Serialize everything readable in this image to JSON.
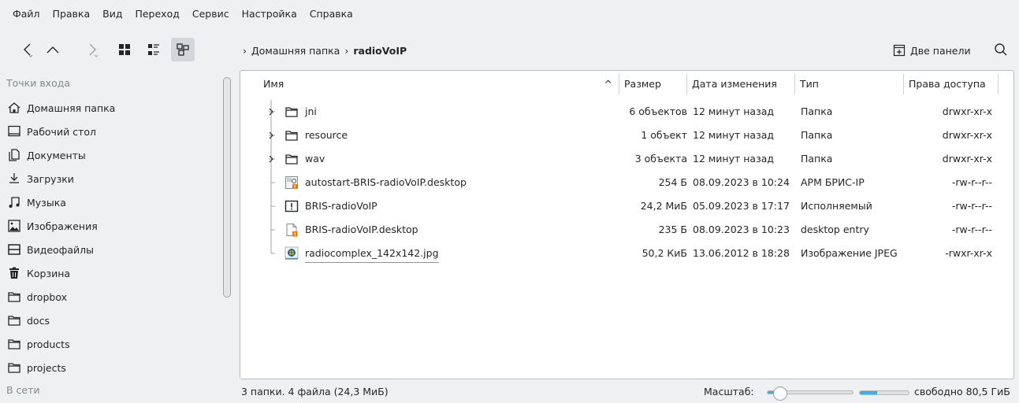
{
  "menu": [
    "Файл",
    "Правка",
    "Вид",
    "Переход",
    "Сервис",
    "Настройка",
    "Справка"
  ],
  "breadcrumb": {
    "home": "Домашняя папка",
    "current": "radioVoIP"
  },
  "toolbar": {
    "two_panels": "Две панели"
  },
  "sidebar": {
    "places_title": "Точки входа",
    "network_title": "В сети",
    "items": [
      {
        "label": "Домашняя папка",
        "icon": "home-icon"
      },
      {
        "label": "Рабочий стол",
        "icon": "desktop-icon"
      },
      {
        "label": "Документы",
        "icon": "documents-icon"
      },
      {
        "label": "Загрузки",
        "icon": "download-icon"
      },
      {
        "label": "Музыка",
        "icon": "music-icon"
      },
      {
        "label": "Изображения",
        "icon": "pictures-icon"
      },
      {
        "label": "Видеофайлы",
        "icon": "videos-icon"
      },
      {
        "label": "Корзина",
        "icon": "trash-icon"
      },
      {
        "label": "dropbox",
        "icon": "folder-icon"
      },
      {
        "label": "docs",
        "icon": "folder-icon"
      },
      {
        "label": "products",
        "icon": "folder-icon"
      },
      {
        "label": "projects",
        "icon": "folder-icon"
      }
    ]
  },
  "columns": {
    "name": "Имя",
    "size": "Размер",
    "modified": "Дата изменения",
    "type": "Тип",
    "perms": "Права доступа"
  },
  "files": [
    {
      "name": "jni",
      "size": "6 объектов",
      "modified": "12 минут назад",
      "type": "Папка",
      "perms": "drwxr-xr-x",
      "kind": "folder"
    },
    {
      "name": "resource",
      "size": "1 объект",
      "modified": "12 минут назад",
      "type": "Папка",
      "perms": "drwxr-xr-x",
      "kind": "folder"
    },
    {
      "name": "wav",
      "size": "3 объекта",
      "modified": "12 минут назад",
      "type": "Папка",
      "perms": "drwxr-xr-x",
      "kind": "folder"
    },
    {
      "name": "autostart-BRIS-radioVoIP.desktop",
      "size": "254 Б",
      "modified": "08.09.2023 в 10:24",
      "type": "АРМ БРИС-IP",
      "perms": "-rw-r--r--",
      "kind": "desktop-app"
    },
    {
      "name": "BRIS-radioVoIP",
      "size": "24,2 МиБ",
      "modified": "05.09.2023 в 17:17",
      "type": "Исполняемый",
      "perms": "-rw-r--r--",
      "kind": "executable"
    },
    {
      "name": "BRIS-radioVoIP.desktop",
      "size": "235 Б",
      "modified": "08.09.2023 в 10:23",
      "type": "desktop entry",
      "perms": "-rw-r--r--",
      "kind": "desktop-entry"
    },
    {
      "name": "radiocomplex_142x142.jpg",
      "size": "50,2 КиБ",
      "modified": "13.06.2012 в 18:28",
      "type": "Изображение JPEG",
      "perms": "-rwxr-xr-x",
      "kind": "image"
    }
  ],
  "status": {
    "summary": "3 папки. 4 файла (24,3 МиБ)",
    "zoom_label": "Масштаб:",
    "zoom_level": 0.08,
    "free_space": "свободно 80,5 ГиБ",
    "used_fraction": 0.35
  },
  "colors": {
    "accent": "#3daee9",
    "background": "#eff0f1",
    "panel": "#ffffff",
    "warning": "#f67400"
  }
}
